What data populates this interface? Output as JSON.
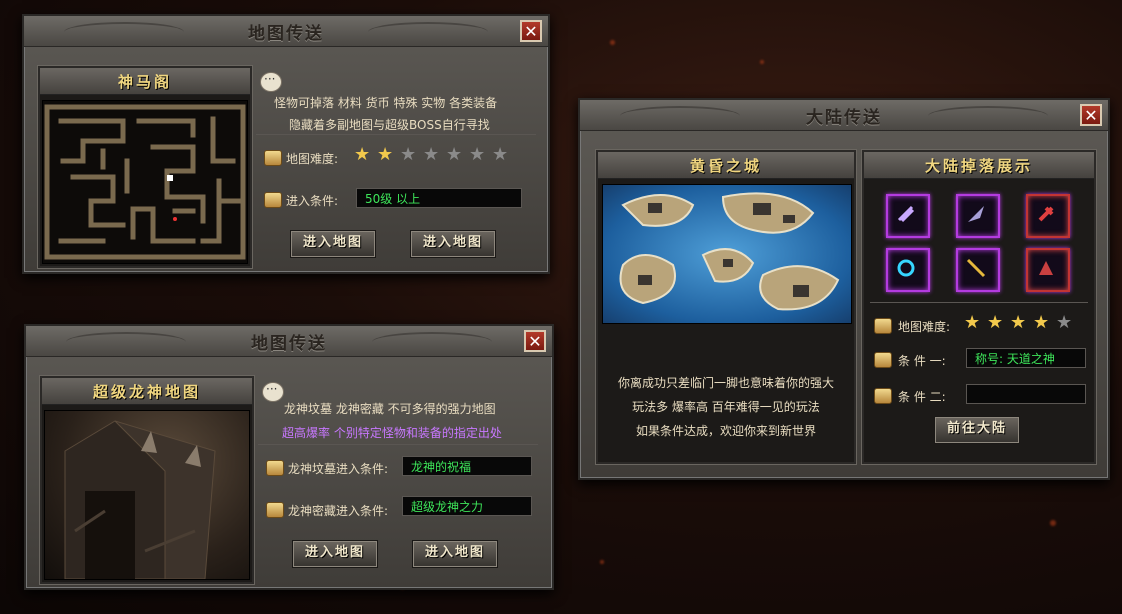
{
  "panel1": {
    "title": "地图传送",
    "close": "✕",
    "map_name": "神马阁",
    "desc_line1": "怪物可掉落 材料 货币 特殊 实物 各类装备",
    "desc_line2": "隐藏着多副地图与超级BOSS自行寻找",
    "difficulty_label": "地图难度:",
    "difficulty_stars": 2,
    "difficulty_max": 7,
    "condition_label": "进入条件:",
    "condition_value": "50级 以上",
    "button1": "进入地图",
    "button2": "进入地图"
  },
  "panel2": {
    "title": "地图传送",
    "close": "✕",
    "map_name": "超级龙神地图",
    "desc_line1": "龙神坟墓 龙神密藏 不可多得的强力地图",
    "desc_line2": "超高爆率 个别特定怪物和装备的指定出处",
    "condition1_label": "龙神坟墓进入条件:",
    "condition1_value": "龙神的祝福",
    "condition2_label": "龙神密藏进入条件:",
    "condition2_value": "超级龙神之力",
    "button1": "进入地图",
    "button2": "进入地图"
  },
  "panel3": {
    "title": "大陆传送",
    "close": "✕",
    "map_name": "黄昏之城",
    "drops_title": "大陆掉落展示",
    "desc_line1": "你离成功只差临门一脚也意味着你的强大",
    "desc_line2": "玩法多 爆率高 百年难得一见的玩法",
    "desc_line3": "如果条件达成，欢迎你来到新世界",
    "difficulty_label": "地图难度:",
    "difficulty_stars": 4,
    "difficulty_max": 5,
    "condition1_label": "条 件 一:",
    "condition1_value": "称号: 天道之神",
    "condition2_label": "条 件 二:",
    "condition2_value": "",
    "button": "前往大陆",
    "drop_items": [
      "purple-claw-icon",
      "purple-blade-icon",
      "red-axe-icon",
      "cyan-ring-icon",
      "golden-spear-icon",
      "red-beast-icon"
    ]
  },
  "colors": {
    "accent_gold": "#f0d680",
    "green_text": "#3ee65a",
    "purple_text": "#c878ff",
    "star_on": "#f2c94c",
    "star_off": "#8a8a8a"
  }
}
